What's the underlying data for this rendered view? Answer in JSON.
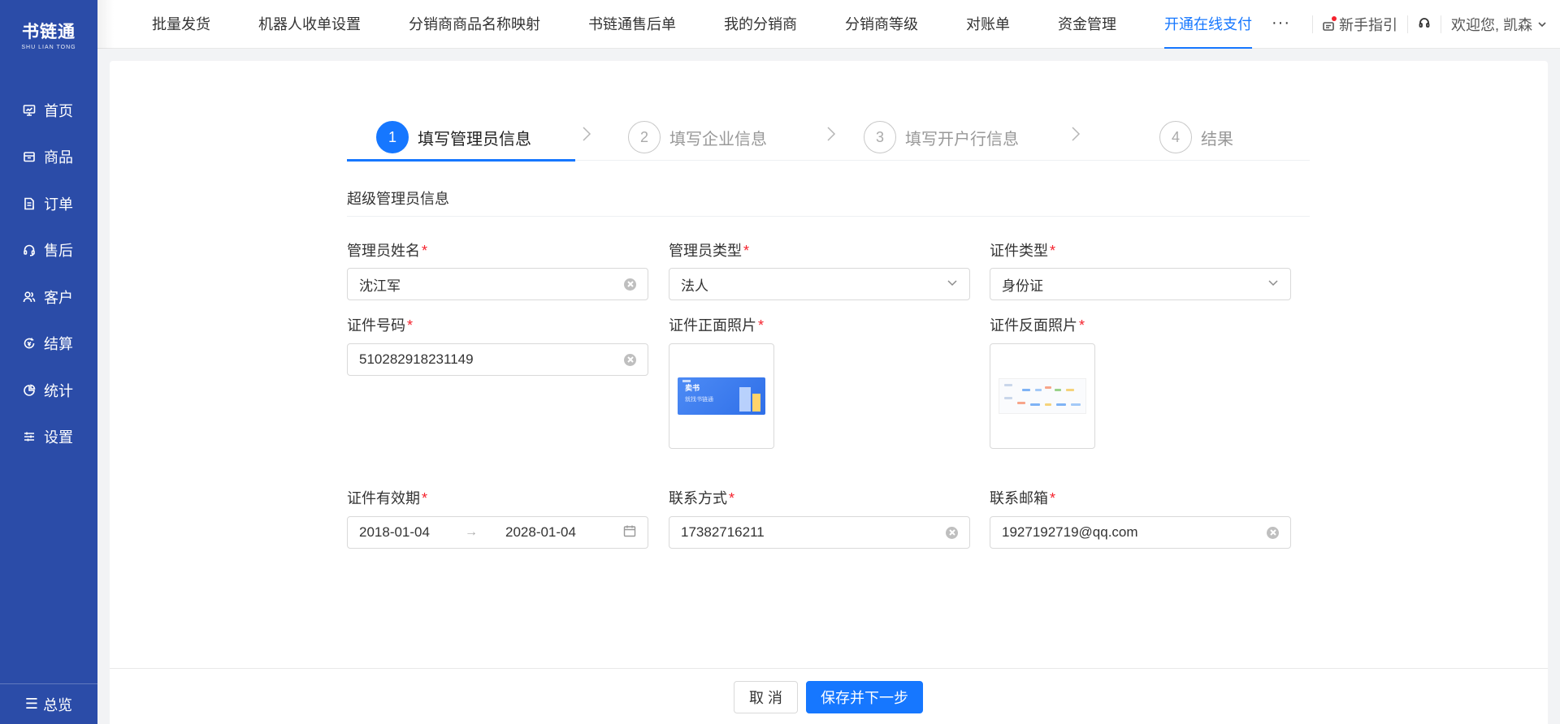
{
  "app": {
    "logo_cn": "书链通",
    "logo_en": "SHU LIAN TONG"
  },
  "sidebar": {
    "items": [
      {
        "label": "首页",
        "icon": "monitor-icon"
      },
      {
        "label": "商品",
        "icon": "box-icon"
      },
      {
        "label": "订单",
        "icon": "document-icon"
      },
      {
        "label": "售后",
        "icon": "headset-icon"
      },
      {
        "label": "客户",
        "icon": "users-icon"
      },
      {
        "label": "结算",
        "icon": "refresh-coin-icon"
      },
      {
        "label": "统计",
        "icon": "pie-chart-icon"
      },
      {
        "label": "设置",
        "icon": "sliders-icon"
      }
    ],
    "bottom_label": "总览",
    "bottom_icon": "☰"
  },
  "topbar": {
    "tabs": [
      {
        "label": "批量发货",
        "active": false
      },
      {
        "label": "机器人收单设置",
        "active": false
      },
      {
        "label": "分销商商品名称映射",
        "active": false
      },
      {
        "label": "书链通售后单",
        "active": false
      },
      {
        "label": "我的分销商",
        "active": false
      },
      {
        "label": "分销商等级",
        "active": false
      },
      {
        "label": "对账单",
        "active": false
      },
      {
        "label": "资金管理",
        "active": false
      },
      {
        "label": "开通在线支付",
        "active": true
      }
    ],
    "more": "···",
    "guide_label": "新手指引",
    "greeting": "欢迎您, 凯森",
    "accent": "#1677ff"
  },
  "steps": [
    {
      "num": "1",
      "label": "填写管理员信息",
      "active": true
    },
    {
      "num": "2",
      "label": "填写企业信息",
      "active": false
    },
    {
      "num": "3",
      "label": "填写开户行信息",
      "active": false
    },
    {
      "num": "4",
      "label": "结果",
      "active": false
    }
  ],
  "section_title": "超级管理员信息",
  "form": {
    "admin_name": {
      "label": "管理员姓名",
      "value": "沈江军"
    },
    "admin_type": {
      "label": "管理员类型",
      "value": "法人"
    },
    "id_type": {
      "label": "证件类型",
      "value": "身份证"
    },
    "id_number": {
      "label": "证件号码",
      "value": "510282918231149"
    },
    "id_front": {
      "label": "证件正面照片",
      "thumb_title": "卖书",
      "thumb_sub": "就找书链通"
    },
    "id_back": {
      "label": "证件反面照片"
    },
    "validity": {
      "label": "证件有效期",
      "start": "2018-01-04",
      "arrow": "→",
      "end": "2028-01-04"
    },
    "phone": {
      "label": "联系方式",
      "value": "17382716211"
    },
    "email": {
      "label": "联系邮箱",
      "value": "1927192719@qq.com"
    },
    "required_mark": "*"
  },
  "footer": {
    "cancel": "取 消",
    "save_next": "保存并下一步"
  }
}
